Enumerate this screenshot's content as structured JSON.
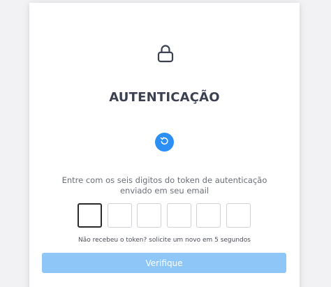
{
  "icons": {
    "lock": "lock-icon",
    "refresh": "refresh-icon"
  },
  "auth": {
    "title": "AUTENTICAÇÃO",
    "instruction_line1": "Entre com os seis digitos do token de autenticação",
    "instruction_line2": "enviado em seu email",
    "resend_note": "Não recebeu o token? solicite um novo em 5 segundos",
    "verify_label": "Verifique",
    "otp_values": [
      "",
      "",
      "",
      "",
      "",
      ""
    ]
  },
  "colors": {
    "accent": "#2b8ff5",
    "button_disabled": "#8ec7f7",
    "title": "#3b4150"
  }
}
